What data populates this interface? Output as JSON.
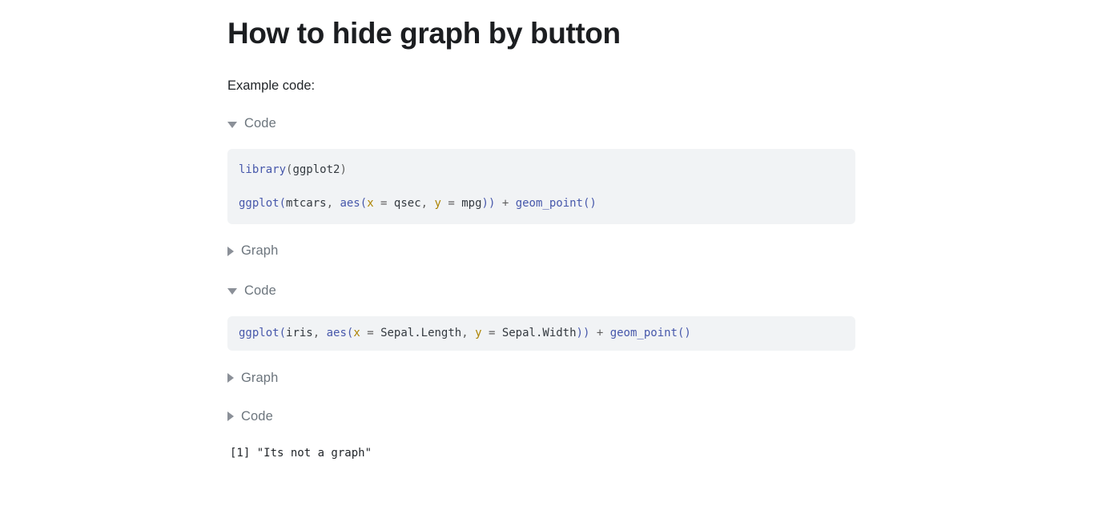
{
  "document": {
    "title": "How to hide graph by button",
    "intro_paragraph": "Example code:"
  },
  "blocks": {
    "fold_code_1": {
      "label": "Code",
      "state": "expanded",
      "arrow": "triangle-down-icon"
    },
    "fold_graph_1": {
      "label": "Graph",
      "state": "collapsed",
      "arrow": "triangle-right-icon"
    },
    "fold_code_2": {
      "label": "Code",
      "state": "expanded",
      "arrow": "triangle-down-icon"
    },
    "fold_graph_2": {
      "label": "Graph",
      "state": "collapsed",
      "arrow": "triangle-right-icon"
    },
    "fold_code_3": {
      "label": "Code",
      "state": "collapsed",
      "arrow": "triangle-right-icon"
    }
  },
  "code_block_1": {
    "line1": {
      "fn": "library",
      "open": "(",
      "arg": "ggplot2",
      "close": ")"
    },
    "line2": {
      "fn1": "ggplot",
      "p1": "(",
      "data": "mtcars",
      "comma1": ", ",
      "fn2": "aes",
      "p2": "(",
      "argx": "x",
      "eq1": " = ",
      "valx": "qsec",
      "comma2": ", ",
      "argy": "y",
      "eq2": " = ",
      "valy": "mpg",
      "p3": "))",
      "plus": " + ",
      "fn3": "geom_point",
      "p4": "()"
    },
    "full_text_line1": "library(ggplot2)",
    "full_text_line2": "ggplot(mtcars, aes(x = qsec, y = mpg)) + geom_point()"
  },
  "code_block_2": {
    "line1": {
      "fn1": "ggplot",
      "p1": "(",
      "data": "iris",
      "comma1": ", ",
      "fn2": "aes",
      "p2": "(",
      "argx": "x",
      "eq1": " = ",
      "valx": "Sepal.Length",
      "comma2": ", ",
      "argy": "y",
      "eq2": " = ",
      "valy": "Sepal.Width",
      "p3": "))",
      "plus": " + ",
      "fn3": "geom_point",
      "p4": "()"
    },
    "full_text": "ggplot(iris, aes(x = Sepal.Length, y = Sepal.Width)) + geom_point()"
  },
  "console_output": {
    "text": "[1] \"Its not a graph\""
  },
  "colors": {
    "page_background": "#ffffff",
    "title": "#1c1e21",
    "body_text": "#212529",
    "fold_label": "#6c757d",
    "fold_arrow": "#8b9098",
    "code_background": "#f1f3f5",
    "token_function": "#4758ab",
    "token_argument": "#ad8301",
    "token_operator": "#5e5e5e",
    "token_plain": "#343a40"
  }
}
